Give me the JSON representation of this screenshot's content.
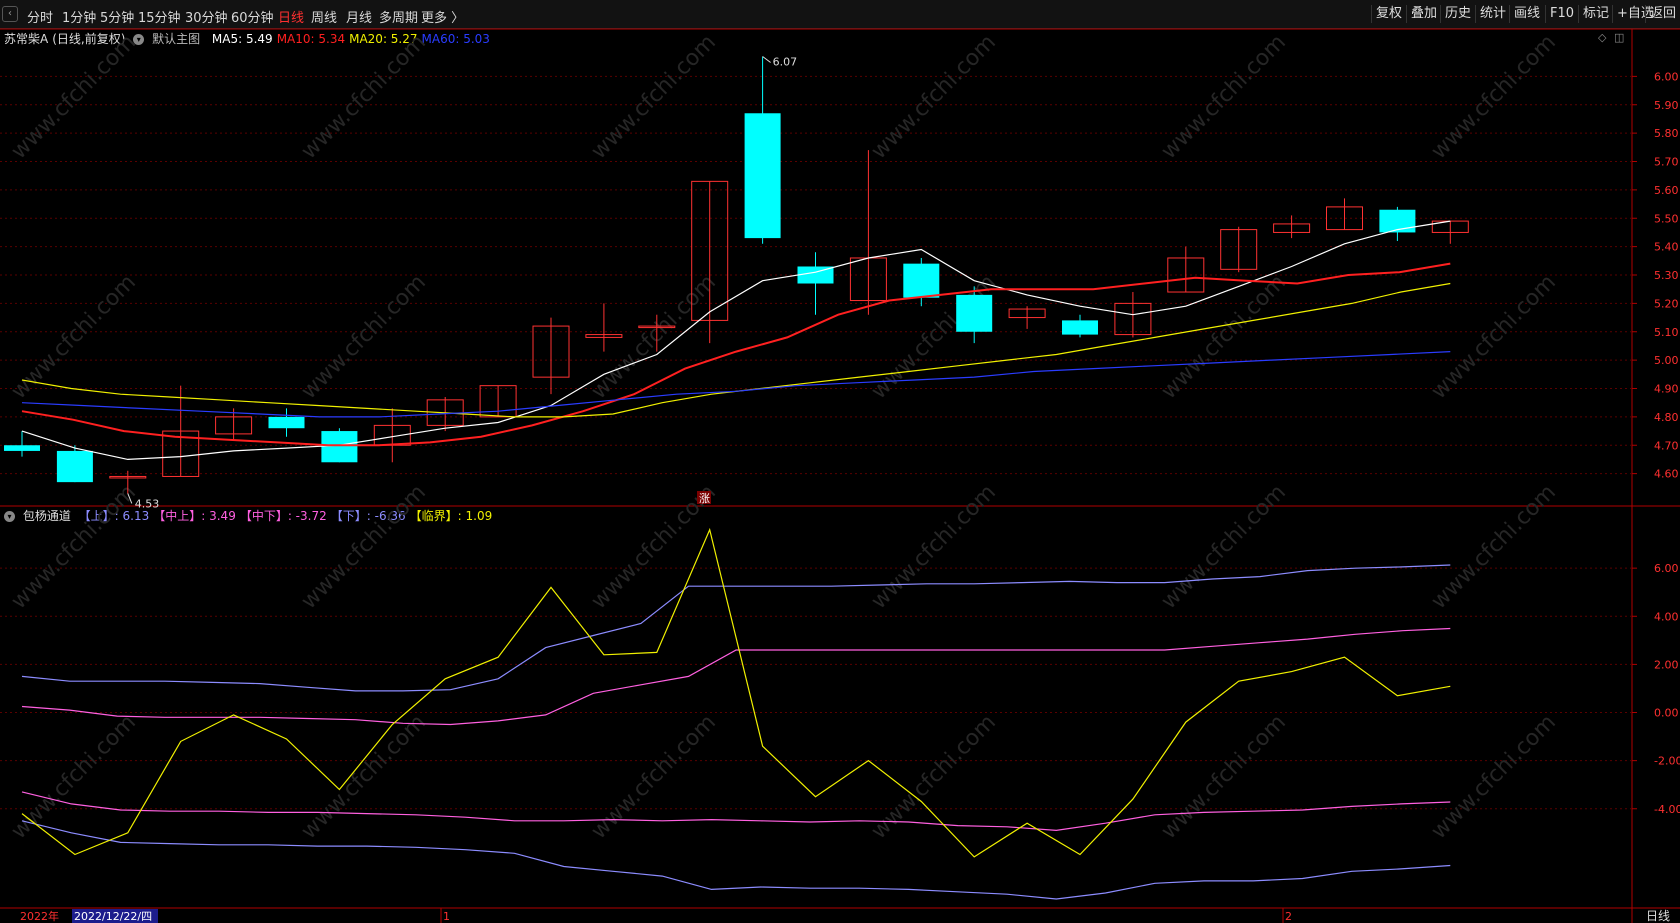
{
  "toolbar": {
    "periods": [
      "分时",
      "1分钟",
      "5分钟",
      "15分钟",
      "30分钟",
      "60分钟",
      "日线",
      "周线",
      "月线",
      "多周期",
      "更多 〉"
    ],
    "active_period": "日线",
    "tools": [
      "复权",
      "叠加",
      "历史",
      "统计",
      "画线",
      "F10",
      "标记",
      "+自选",
      "返回"
    ]
  },
  "main_chart": {
    "stock_name": "苏常柴A",
    "mode": "(日线,前复权)",
    "template": "默认主图",
    "ma": [
      {
        "label": "MA5: 5.49",
        "color": "#ffffff"
      },
      {
        "label": "MA10: 5.34",
        "color": "#ff2020"
      },
      {
        "label": "MA20: 5.27",
        "color": "#f0f000"
      },
      {
        "label": "MA60: 5.03",
        "color": "#2a3cff"
      }
    ],
    "high_label": "6.07",
    "low_label": "4.53",
    "center_badge": "涨",
    "y_ticks": [
      "6.00",
      "5.90",
      "5.80",
      "5.70",
      "5.60",
      "5.50",
      "5.40",
      "5.30",
      "5.20",
      "5.10",
      "5.00",
      "4.90",
      "4.80",
      "4.70",
      "4.60"
    ]
  },
  "sub_chart": {
    "name": "包杨通道",
    "legend": [
      {
        "label": "【上】: 6.13",
        "color": "#8c8cff"
      },
      {
        "label": "【中上】: 3.49",
        "color": "#ff60e0"
      },
      {
        "label": "【中下】: -3.72",
        "color": "#ff60e0"
      },
      {
        "label": "【下】: -6.36",
        "color": "#8c8cff"
      },
      {
        "label": "【临界】: 1.09",
        "color": "#f0f000"
      }
    ],
    "y_ticks": [
      "6.00",
      "4.00",
      "2.00",
      "0.00",
      "-2.00",
      "-4.00"
    ]
  },
  "x_axis": {
    "year_label": "2022年",
    "cursor_date": "2022/12/22/四",
    "month_labels": [
      "1",
      "2"
    ],
    "period_label": "日线"
  },
  "colors": {
    "up": "#ff3232",
    "down": "#00ffff",
    "grid": "#5a0000",
    "axis": "#b00000",
    "tick_text": "#ff3030"
  },
  "watermark": "www.cfchi.com",
  "chart_data": [
    {
      "type": "candlestick",
      "title": "苏常柴A (日线,前复权)",
      "ylim": [
        4.5,
        6.1
      ],
      "candles": [
        {
          "o": 4.7,
          "h": 4.75,
          "l": 4.66,
          "c": 4.68
        },
        {
          "o": 4.68,
          "h": 4.7,
          "l": 4.57,
          "c": 4.57
        },
        {
          "o": 4.59,
          "h": 4.61,
          "l": 4.53,
          "c": 4.59
        },
        {
          "o": 4.59,
          "h": 4.91,
          "l": 4.59,
          "c": 4.75
        },
        {
          "o": 4.74,
          "h": 4.83,
          "l": 4.72,
          "c": 4.8
        },
        {
          "o": 4.8,
          "h": 4.83,
          "l": 4.73,
          "c": 4.76
        },
        {
          "o": 4.75,
          "h": 4.76,
          "l": 4.64,
          "c": 4.64
        },
        {
          "o": 4.7,
          "h": 4.83,
          "l": 4.64,
          "c": 4.77
        },
        {
          "o": 4.77,
          "h": 4.87,
          "l": 4.75,
          "c": 4.86
        },
        {
          "o": 4.8,
          "h": 4.91,
          "l": 4.8,
          "c": 4.91
        },
        {
          "o": 4.94,
          "h": 5.15,
          "l": 4.88,
          "c": 5.12
        },
        {
          "o": 5.08,
          "h": 5.2,
          "l": 5.03,
          "c": 5.09
        },
        {
          "o": 5.12,
          "h": 5.16,
          "l": 5.03,
          "c": 5.12
        },
        {
          "o": 5.14,
          "h": 5.63,
          "l": 5.06,
          "c": 5.63
        },
        {
          "o": 5.87,
          "h": 6.07,
          "l": 5.41,
          "c": 5.43
        },
        {
          "o": 5.33,
          "h": 5.38,
          "l": 5.16,
          "c": 5.27
        },
        {
          "o": 5.21,
          "h": 5.74,
          "l": 5.16,
          "c": 5.36
        },
        {
          "o": 5.34,
          "h": 5.36,
          "l": 5.19,
          "c": 5.22
        },
        {
          "o": 5.23,
          "h": 5.26,
          "l": 5.06,
          "c": 5.1
        },
        {
          "o": 5.15,
          "h": 5.19,
          "l": 5.11,
          "c": 5.18
        },
        {
          "o": 5.14,
          "h": 5.16,
          "l": 5.08,
          "c": 5.09
        },
        {
          "o": 5.09,
          "h": 5.24,
          "l": 5.08,
          "c": 5.2
        },
        {
          "o": 5.24,
          "h": 5.4,
          "l": 5.24,
          "c": 5.36
        },
        {
          "o": 5.32,
          "h": 5.47,
          "l": 5.31,
          "c": 5.46
        },
        {
          "o": 5.45,
          "h": 5.51,
          "l": 5.43,
          "c": 5.48
        },
        {
          "o": 5.46,
          "h": 5.57,
          "l": 5.46,
          "c": 5.54
        },
        {
          "o": 5.53,
          "h": 5.54,
          "l": 5.42,
          "c": 5.45
        },
        {
          "o": 5.45,
          "h": 5.49,
          "l": 5.41,
          "c": 5.49
        }
      ],
      "series": [
        {
          "name": "MA5",
          "values": [
            4.75,
            4.69,
            4.65,
            4.66,
            4.68,
            4.69,
            4.7,
            4.73,
            4.76,
            4.78,
            4.84,
            4.95,
            5.02,
            5.17,
            5.28,
            5.31,
            5.36,
            5.39,
            5.28,
            5.23,
            5.19,
            5.16,
            5.19,
            5.26,
            5.33,
            5.41,
            5.46,
            5.49
          ]
        },
        {
          "name": "MA10",
          "values": [
            4.82,
            4.79,
            4.75,
            4.73,
            4.72,
            4.71,
            4.7,
            4.7,
            4.71,
            4.73,
            4.77,
            4.82,
            4.88,
            4.97,
            5.03,
            5.08,
            5.16,
            5.21,
            5.23,
            5.25,
            5.25,
            5.25,
            5.27,
            5.29,
            5.28,
            5.27,
            5.3,
            5.31,
            5.34
          ]
        },
        {
          "name": "MA20",
          "values": [
            4.93,
            4.9,
            4.88,
            4.87,
            4.86,
            4.85,
            4.84,
            4.83,
            4.82,
            4.81,
            4.8,
            4.8,
            4.81,
            4.85,
            4.88,
            4.9,
            4.92,
            4.94,
            4.96,
            4.98,
            5.0,
            5.02,
            5.05,
            5.08,
            5.11,
            5.14,
            5.17,
            5.2,
            5.24,
            5.27
          ]
        },
        {
          "name": "MA60",
          "values": [
            4.85,
            4.84,
            4.83,
            4.82,
            4.81,
            4.8,
            4.8,
            4.81,
            4.82,
            4.84,
            4.86,
            4.88,
            4.89,
            4.91,
            4.92,
            4.93,
            4.94,
            4.96,
            4.97,
            4.98,
            4.99,
            5.0,
            5.01,
            5.02,
            5.03
          ]
        }
      ]
    },
    {
      "type": "line",
      "title": "包杨通道",
      "ylim": [
        -8,
        8.5
      ],
      "series": [
        {
          "name": "上",
          "values": [
            1.5,
            1.3,
            1.3,
            1.3,
            1.25,
            1.2,
            1.05,
            0.9,
            0.9,
            0.95,
            1.4,
            2.7,
            3.2,
            3.7,
            5.25,
            5.25,
            5.25,
            5.25,
            5.3,
            5.35,
            5.35,
            5.4,
            5.45,
            5.4,
            5.4,
            5.55,
            5.65,
            5.9,
            6.0,
            6.05,
            6.13
          ]
        },
        {
          "name": "中上",
          "values": [
            0.25,
            0.1,
            -0.15,
            -0.2,
            -0.2,
            -0.2,
            -0.25,
            -0.3,
            -0.45,
            -0.5,
            -0.35,
            -0.1,
            0.8,
            1.15,
            1.5,
            2.6,
            2.6,
            2.6,
            2.6,
            2.6,
            2.6,
            2.6,
            2.6,
            2.6,
            2.6,
            2.75,
            2.9,
            3.05,
            3.25,
            3.4,
            3.49
          ]
        },
        {
          "name": "中下",
          "values": [
            -3.3,
            -3.8,
            -4.05,
            -4.1,
            -4.1,
            -4.15,
            -4.15,
            -4.2,
            -4.25,
            -4.35,
            -4.5,
            -4.5,
            -4.45,
            -4.5,
            -4.45,
            -4.5,
            -4.55,
            -4.5,
            -4.55,
            -4.7,
            -4.75,
            -4.9,
            -4.6,
            -4.25,
            -4.15,
            -4.1,
            -4.05,
            -3.9,
            -3.8,
            -3.72
          ]
        },
        {
          "name": "下",
          "values": [
            -4.5,
            -5.0,
            -5.4,
            -5.45,
            -5.5,
            -5.5,
            -5.55,
            -5.55,
            -5.6,
            -5.7,
            -5.85,
            -6.4,
            -6.6,
            -6.8,
            -7.35,
            -7.25,
            -7.3,
            -7.3,
            -7.35,
            -7.45,
            -7.55,
            -7.75,
            -7.5,
            -7.1,
            -7.0,
            -7.0,
            -6.9,
            -6.6,
            -6.5,
            -6.36
          ]
        },
        {
          "name": "临界",
          "values": [
            -4.2,
            -5.9,
            -5.0,
            -1.2,
            -0.1,
            -1.1,
            -3.2,
            -0.5,
            1.4,
            2.3,
            5.2,
            2.4,
            2.5,
            7.6,
            -1.4,
            -3.5,
            -2.0,
            -3.7,
            -6.0,
            -4.6,
            -5.9,
            -3.6,
            -0.4,
            1.3,
            1.7,
            2.3,
            0.7,
            1.09
          ]
        }
      ]
    }
  ]
}
